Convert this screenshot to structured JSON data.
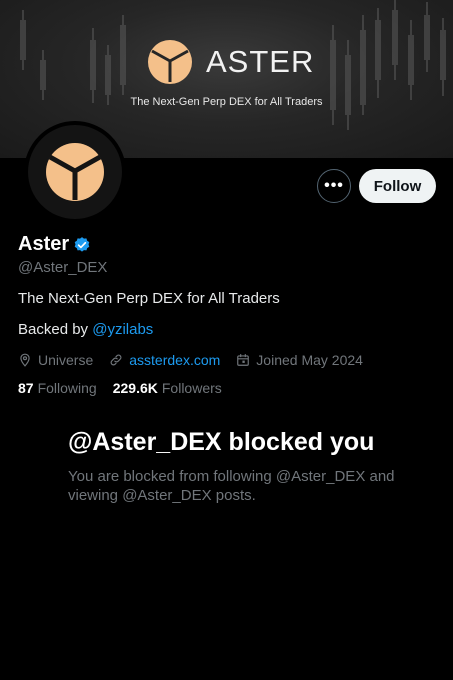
{
  "banner": {
    "brand_name": "ASTER",
    "tagline": "The Next-Gen Perp DEX for All Traders",
    "logo_icon": "aster-logo-icon"
  },
  "actions": {
    "more_label": "•••",
    "follow_label": "Follow"
  },
  "profile": {
    "display_name": "Aster",
    "handle": "@Aster_DEX",
    "bio": "The Next-Gen Perp DEX for All Traders",
    "backed_prefix": "Backed by ",
    "backed_mention": "@yzilabs",
    "location": "Universe",
    "website": "assterdex.com",
    "joined": "Joined May 2024",
    "following_count": "87",
    "following_label": "Following",
    "followers_count": "229.6K",
    "followers_label": "Followers"
  },
  "blocked": {
    "title": "@Aster_DEX blocked you",
    "description": "You are blocked from following @Aster_DEX and viewing @Aster_DEX posts."
  },
  "colors": {
    "accent": "#1d9bf0",
    "logo_orange": "#f4c08a",
    "muted": "#71767b"
  }
}
